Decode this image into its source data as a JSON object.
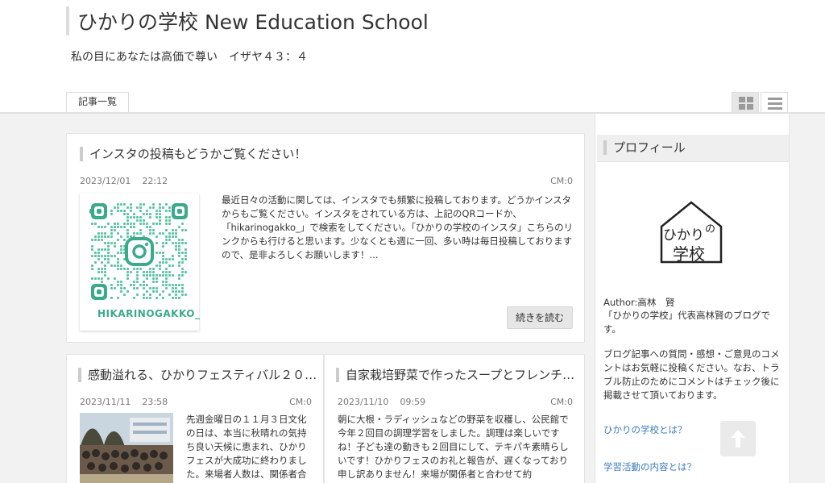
{
  "header": {
    "site_title": "ひかりの学校 New Education School",
    "site_description": "私の目にあなたは高価で尊い　イザヤ４３：４"
  },
  "nav": {
    "tab_label": "記事一覧",
    "view_icons": [
      "grid-view-icon",
      "list-view-icon"
    ]
  },
  "posts": [
    {
      "title": "インスタの投稿もどうかご覧ください！",
      "date": "2023/12/01",
      "time": "22:12",
      "comments": "CM:0",
      "excerpt": "最近日々の活動に関しては、インスタでも頻繁に投稿しております。どうかインスタからもご覧ください。インスタをされている方は、上記のQRコードか、「hikarinogakko_」で検索をしてください。「ひかりの学校のインスタ」こちらのリンクからも行けると思います。少なくとも週に一回、多い時は毎日投稿しておりますので、是非よろしくお願いします！...",
      "read_more": "続きを読む",
      "qr_caption": "HIKARINOGAKKO_"
    },
    {
      "title": "感動溢れる、ひかりフェスティバル２０…",
      "date": "2023/11/11",
      "time": "23:58",
      "comments": "CM:0",
      "excerpt": "先週金曜日の１１月３日文化の日は、本当に秋晴れの気持ち良い天候に恵まれ、ひかりフェスが大成功に終わりました。来場者人数は、関係者合"
    },
    {
      "title": "自家栽培野菜で作ったスープとフレンチ…",
      "date": "2023/11/10",
      "time": "09:59",
      "comments": "CM:0",
      "excerpt": "朝に大根・ラディッシュなどの野菜を収穫し、公民館で今年２回目の調理学習をしました。調理は楽しいですね！子ども達の動きも２回目にして、テキパキ素晴らしいです！ひかりフェスのお礼と報告が、遅くなっており申し訳ありません！来場が関係者と合わせて約"
    }
  ],
  "sidebar": {
    "title": "プロフィール",
    "logo_text_1": "ひかり",
    "logo_text_2": "の",
    "logo_text_3": "学校",
    "author": "Author:高林　賢",
    "bio": "「ひかりの学校」代表高林賢のブログです。",
    "notice": "ブログ記事への質問・感想・ご意見のコメントはお気軽に投稿ください。なお、トラブル防止のためにコメントはチェック後に掲載させて頂いております。",
    "links": [
      "ひかりの学校とは？",
      "学習活動の内容とは？"
    ]
  },
  "colors": {
    "link": "#3a7bbf",
    "qr": "#3aaa8a",
    "background": "#f2f2f2"
  }
}
